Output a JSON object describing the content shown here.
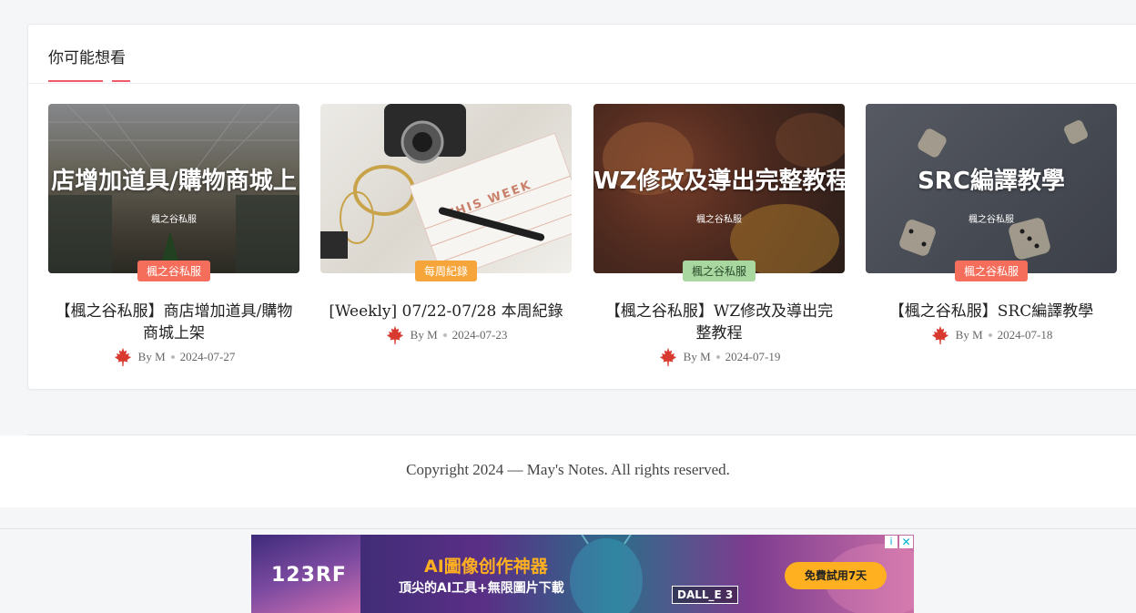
{
  "section": {
    "title": "你可能想看",
    "accent_color": "#ef5b6b"
  },
  "posts": [
    {
      "thumb_title": "店增加道具/購物商城上",
      "thumb_subtitle": "楓之谷私服",
      "category": "楓之谷私服",
      "category_color": "#f46e5b",
      "title": "【楓之谷私服】商店增加道具/購物商城上架",
      "author": "By M",
      "date": "2024-07-27"
    },
    {
      "thumb_title": "",
      "thumb_subtitle": "",
      "thumb_photo_text": "THIS WEEK",
      "category": "每周紀錄",
      "category_color": "#f6a53a",
      "title": "[Weekly] 07/22-07/28 本周紀錄",
      "author": "By M",
      "date": "2024-07-23"
    },
    {
      "thumb_title": "WZ修改及導出完整教程",
      "thumb_subtitle": "楓之谷私服",
      "category": "楓之谷私服",
      "category_color": "#a8d8a0",
      "title": "【楓之谷私服】WZ修改及導出完整教程",
      "author": "By M",
      "date": "2024-07-19"
    },
    {
      "thumb_title": "SRC編譯教學",
      "thumb_subtitle": "楓之谷私服",
      "category": "楓之谷私服",
      "category_color": "#f46e5b",
      "title": "【楓之谷私服】SRC編譯教學",
      "author": "By M",
      "date": "2024-07-18"
    }
  ],
  "footer": {
    "copyright": "Copyright 2024 — May's Notes. All rights reserved."
  },
  "ad": {
    "brand": "123RF",
    "headline": "AI圖像创作神器",
    "subline": "頂尖的AI工具+無限圖片下載",
    "badge": "DALL_E 3",
    "cta": "免費試用7天",
    "info_icon": "i",
    "close_icon": "✕"
  }
}
